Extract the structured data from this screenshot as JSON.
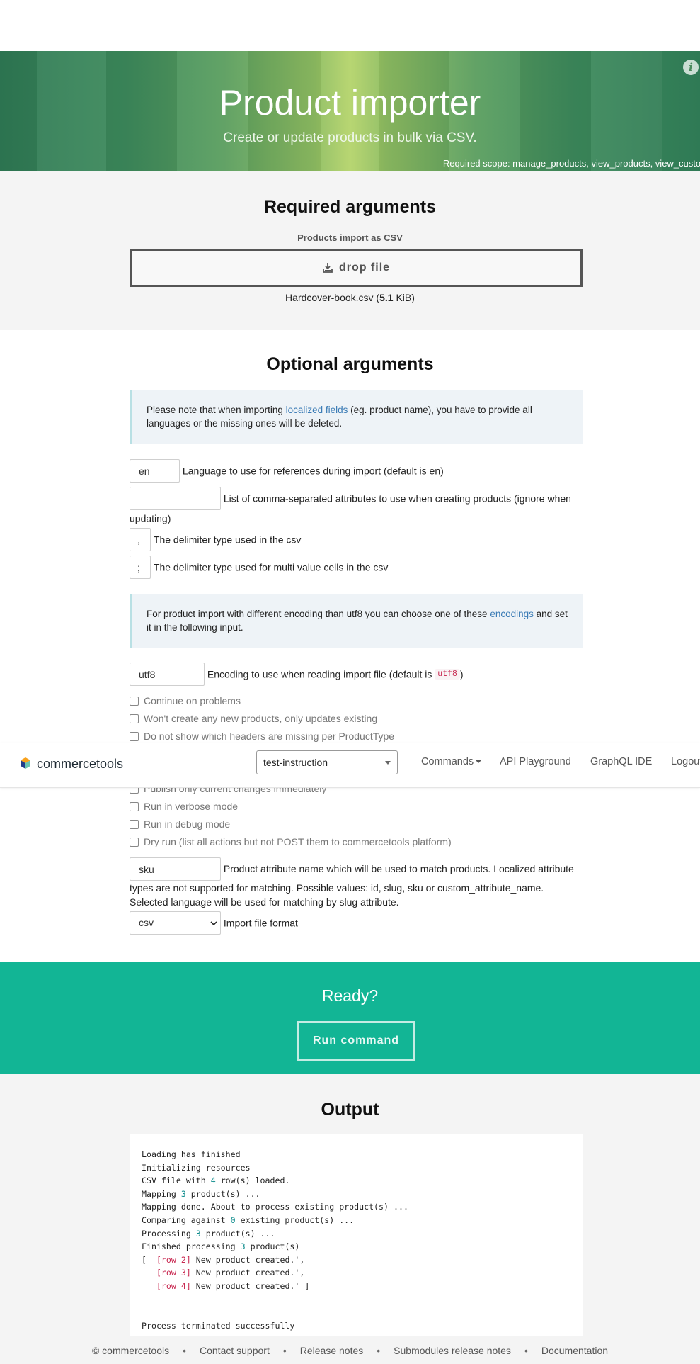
{
  "hero": {
    "title": "Product importer",
    "subtitle": "Create or update products in bulk via CSV.",
    "scope": "Required scope: manage_products, view_products, view_customers",
    "info_glyph": "i"
  },
  "required": {
    "title": "Required arguments",
    "label": "Products import as CSV",
    "dropzone_label": "drop file",
    "file_name": "Hardcover-book.csv",
    "file_size_value": "5.1",
    "file_size_unit": "KiB"
  },
  "optional": {
    "title": "Optional arguments",
    "note1_before": "Please note that when importing ",
    "note1_link": "localized fields",
    "note1_after": " (eg. product name), you have to provide all languages or the missing ones will be deleted.",
    "language_value": "en",
    "language_label": "Language to use for references during import (default is en)",
    "attributes_value": "",
    "attributes_label": "List of comma-separated attributes to use when creating products (ignore when updating)",
    "csv_delimiter_value": ",",
    "csv_delimiter_label": "The delimiter type used in the csv",
    "multi_delimiter_value": ";",
    "multi_delimiter_label": "The delimiter type used for multi value cells in the csv",
    "note2_before": "For product import with different encoding than utf8 you can choose one of these ",
    "note2_link": "encodings",
    "note2_after": " and set it in the following input.",
    "encoding_value": "utf8",
    "encoding_label": "Encoding to use when reading import file (default is ",
    "encoding_code": "utf8",
    "encoding_close": ")",
    "checkboxes": [
      "Continue on problems",
      "Won't create any new products, only updates existing",
      "Do not show which headers are missing per ProductType",
      "Publish only current changes immediately",
      "Run in verbose mode",
      "Run in debug mode",
      "Dry run (list all actions but not POST them to commercetools platform)"
    ],
    "match_value": "sku",
    "match_label": "Product attribute name which will be used to match products. Localized attribute types are not supported for matching. Possible values: id, slug, sku or custom_attribute_name. Selected language will be used for matching by slug attribute.",
    "format_value": "csv",
    "format_label": "Import file format"
  },
  "navbar": {
    "logo_text": "commercetools",
    "project": "test-instruction",
    "links": [
      "Commands",
      "API Playground",
      "GraphQL IDE",
      "Logout"
    ]
  },
  "ready": {
    "title": "Ready?",
    "button": "Run command"
  },
  "output": {
    "title": "Output",
    "lines": {
      "l1": "Loading has finished",
      "l2": "Initializing resources",
      "l3_a": "CSV file with ",
      "l3_n": "4",
      "l3_b": " row(s) loaded.",
      "l4_a": "Mapping ",
      "l4_n": "3",
      "l4_b": " product(s) ...",
      "l5": "Mapping done. About to process existing product(s) ...",
      "l6_a": "Comparing against ",
      "l6_n": "0",
      "l6_b": " existing product(s) ...",
      "l7_a": "Processing ",
      "l7_n": "3",
      "l7_b": " product(s) ...",
      "l8_a": "Finished processing ",
      "l8_n": "3",
      "l8_b": " product(s)",
      "r1_pre": "[ '",
      "r1_tag": "[row 2]",
      "r1_post": " New product created.',",
      "r2_pre": "  '",
      "r2_tag": "[row 3]",
      "r2_post": " New product created.',",
      "r3_pre": "  '",
      "r3_tag": "[row 4]",
      "r3_post": " New product created.' ]",
      "end": "Process terminated successfully"
    }
  },
  "footer": {
    "items": [
      "© commercetools",
      "Contact support",
      "Release notes",
      "Submodules release notes",
      "Documentation"
    ],
    "separator": "•"
  },
  "colors": {
    "hero_green": "#3d8a5c",
    "ready_teal": "#12b595",
    "link_blue": "#3a7bb5",
    "code_red": "#c7254e"
  },
  "icons": {
    "info": "info-icon",
    "upload": "upload-icon",
    "logo": "commercetools-logo-icon",
    "caret": "chevron-down-icon"
  }
}
